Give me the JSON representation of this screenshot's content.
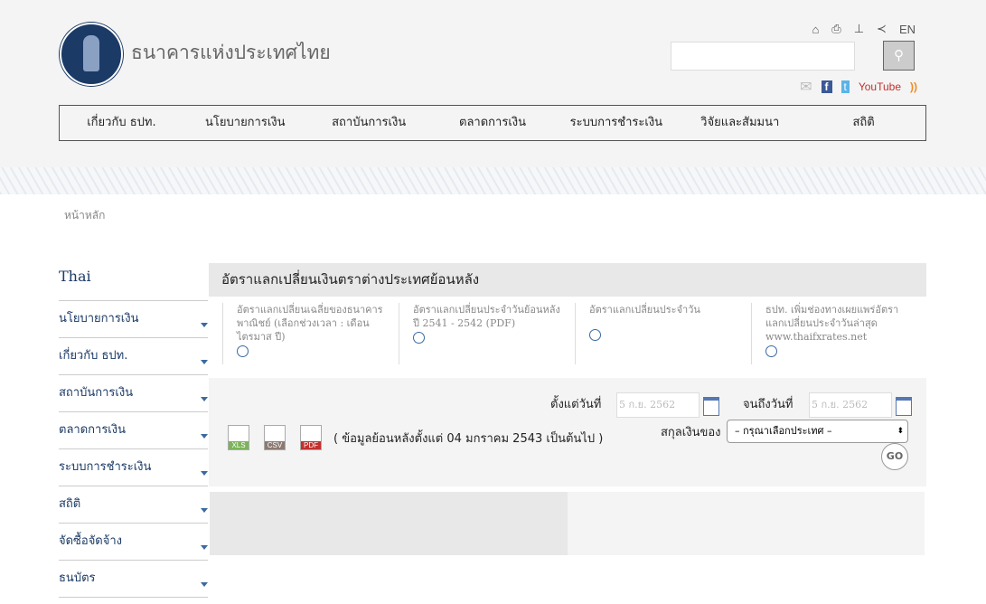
{
  "header": {
    "brand": "ธนาคารแห่งประเทศไทย",
    "lang": "EN",
    "youtube": "YouTube"
  },
  "nav": [
    "เกี่ยวกับ ธปท.",
    "นโยบายการเงิน",
    "สถาบันการเงิน",
    "ตลาดการเงิน",
    "ระบบการชำระเงิน",
    "วิจัยและสัมมนา",
    "สถิติ"
  ],
  "breadcrumb": "หน้าหลัก",
  "sidebar": {
    "heading": "Thai",
    "items": [
      "นโยบายการเงิน",
      "เกี่ยวกับ ธปท.",
      "สถาบันการเงิน",
      "ตลาดการเงิน",
      "ระบบการชำระเงิน",
      "สถิติ",
      "จัดซื้อจัดจ้าง",
      "ธนบัตร"
    ]
  },
  "panel": {
    "title": "อัตราแลกเปลี่ยนเงินตราต่างประเทศย้อนหลัง",
    "links": [
      "อัตราแลกเปลี่ยนเฉลี่ยของธนาคารพาณิชย์ (เลือกช่วงเวลา : เดือน ไตรมาส ปี)",
      "อัตราแลกเปลี่ยนประจำวันย้อนหลัง ปี 2541 - 2542 (PDF)",
      "อัตราแลกเปลี่ยนประจำวัน",
      "ธปท. เพิ่มช่องทางเผยแพร่อัตราแลกเปลี่ยนประจำวันล่าสุด www.thaifxrates.net"
    ]
  },
  "form": {
    "from_label": "ตั้งแต่วันที่",
    "to_label": "จนถึงวันที่",
    "from_placeholder": "5 ก.ย. 2562",
    "to_placeholder": "5 ก.ย. 2562",
    "currency_label": "สกุลเงินของ",
    "currency_value": "– กรุณาเลือกประเทศ –",
    "go": "GO",
    "xls": "XLS",
    "csv": "CSV",
    "pdf": "PDF",
    "note": "( ข้อมูลย้อนหลังตั้งแต่ 04 มกราคม 2543 เป็นต้นไป )"
  }
}
